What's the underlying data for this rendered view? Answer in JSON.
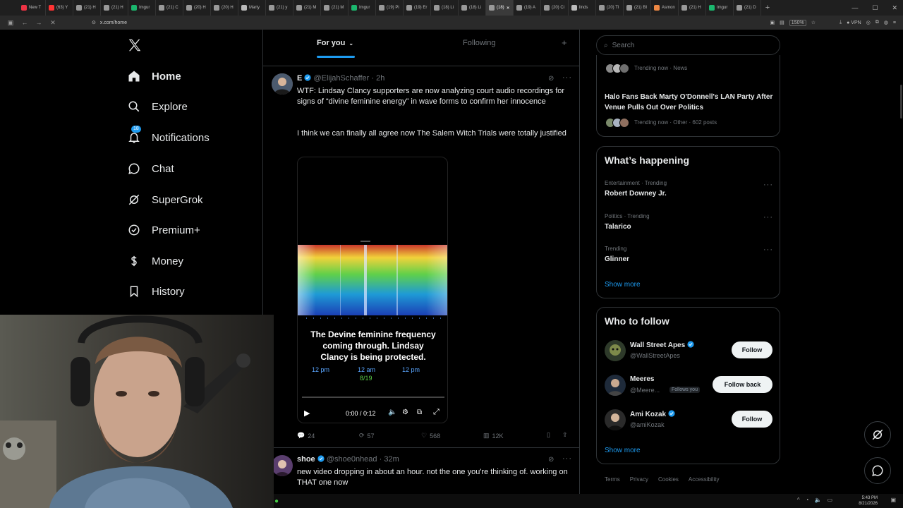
{
  "browser": {
    "tabs": [
      {
        "label": "New T",
        "color": "#e34"
      },
      {
        "label": "(63) Y",
        "color": "#f33"
      },
      {
        "label": "(21) H",
        "color": "#999"
      },
      {
        "label": "(21) H",
        "color": "#999"
      },
      {
        "label": "Imgur",
        "color": "#1bb76e"
      },
      {
        "label": "(21) C",
        "color": "#999"
      },
      {
        "label": "(20) H",
        "color": "#999"
      },
      {
        "label": "(20) H",
        "color": "#999"
      },
      {
        "label": "Marty",
        "color": "#bbb"
      },
      {
        "label": "(21) y",
        "color": "#999"
      },
      {
        "label": "(21) M",
        "color": "#999"
      },
      {
        "label": "(21) M",
        "color": "#999"
      },
      {
        "label": "Imgur",
        "color": "#1bb76e"
      },
      {
        "label": "(19) Pi",
        "color": "#999"
      },
      {
        "label": "(19) Er",
        "color": "#999"
      },
      {
        "label": "(18) Li",
        "color": "#999"
      },
      {
        "label": "(18) Li",
        "color": "#999"
      },
      {
        "label": "(18)",
        "color": "#999",
        "active": true
      },
      {
        "label": "(19) A",
        "color": "#999"
      },
      {
        "label": "(20) Ci",
        "color": "#999"
      },
      {
        "label": "linds",
        "color": "#bbb"
      },
      {
        "label": "(20) Tl",
        "color": "#999"
      },
      {
        "label": "(21) BI",
        "color": "#999"
      },
      {
        "label": "Asmon",
        "color": "#e84"
      },
      {
        "label": "(21) H",
        "color": "#999"
      },
      {
        "label": "Imgur",
        "color": "#1bb76e"
      },
      {
        "label": "(21) D",
        "color": "#999"
      }
    ],
    "new_tab": "+",
    "url": "x.com/home",
    "vpn_label": "VPN",
    "zoom": "150%"
  },
  "sidebar": {
    "items": [
      {
        "label": "Home",
        "icon": "home-icon",
        "bold": true
      },
      {
        "label": "Explore",
        "icon": "search-icon"
      },
      {
        "label": "Notifications",
        "icon": "bell-icon",
        "badge": "18"
      },
      {
        "label": "Chat",
        "icon": "chat-icon"
      },
      {
        "label": "SuperGrok",
        "icon": "grok-icon"
      },
      {
        "label": "Premium+",
        "icon": "verified-icon"
      },
      {
        "label": "Money",
        "icon": "dollar-icon"
      },
      {
        "label": "History",
        "icon": "bookmark-icon"
      }
    ]
  },
  "timeline": {
    "tab_for_you": "For you",
    "tab_following": "Following",
    "add": "+",
    "tweet1": {
      "name": "E",
      "handle": "@ElijahSchaffer",
      "time": "· 2h",
      "text1": "WTF: Lindsay Clancy supporters are now analyzing court audio recordings for signs of “divine feminine energy” in wave forms to confirm her innocence",
      "text2": "I think we can finally all agree now The Salem Witch Trials were totally justified",
      "video": {
        "caption": "The Devine feminine frequency coming through. Lindsay Clancy is being protected.",
        "tick1": "12 pm",
        "tick2": "12 am",
        "tick3": "12 pm",
        "date": "8/19",
        "time": "0:00 / 0:12",
        "progress": 0
      },
      "replies": "24",
      "reposts": "57",
      "likes": "568",
      "views": "12K"
    },
    "tweet2": {
      "name": "shoe",
      "handle": "@shoe0nhead",
      "time": "· 32m",
      "text": "new video dropping in about an hour. not the one you're thinking of. working on THAT one now"
    }
  },
  "right": {
    "search_placeholder": "Search",
    "trending_top": {
      "meta": "Trending now · News"
    },
    "halo": {
      "title": "Halo Fans Back Marty O'Donnell's LAN Party After Venue Pulls Out Over Politics",
      "meta": "Trending now · Other · 602 posts"
    },
    "whats_happening": {
      "heading": "What’s happening",
      "trends": [
        {
          "meta": "Entertainment · Trending",
          "name": "Robert Downey Jr."
        },
        {
          "meta": "Politics · Trending",
          "name": "Talarico"
        },
        {
          "meta": "Trending",
          "name": "Glinner"
        }
      ],
      "show_more": "Show more"
    },
    "who_to_follow": {
      "heading": "Who to follow",
      "accounts": [
        {
          "name": "Wall Street Apes",
          "handle": "@WallStreetApes",
          "button": "Follow",
          "verified": true
        },
        {
          "name": "Meeres",
          "handle": "@Meere...",
          "follows_you": "Follows you",
          "button": "Follow back",
          "verified": false
        },
        {
          "name": "Ami Kozak",
          "handle": "@amiKozak",
          "button": "Follow",
          "verified": true
        }
      ],
      "show_more": "Show more"
    },
    "footer": [
      "Terms",
      "Privacy",
      "Cookies",
      "Accessibility"
    ]
  },
  "taskbar": {
    "time": "5:43 PM",
    "date": "8/21/2026"
  },
  "colors": {
    "accent": "#1d9bf0",
    "background": "#000000",
    "text": "#e7e9ea",
    "muted": "#71767b",
    "border": "#2f3336"
  }
}
